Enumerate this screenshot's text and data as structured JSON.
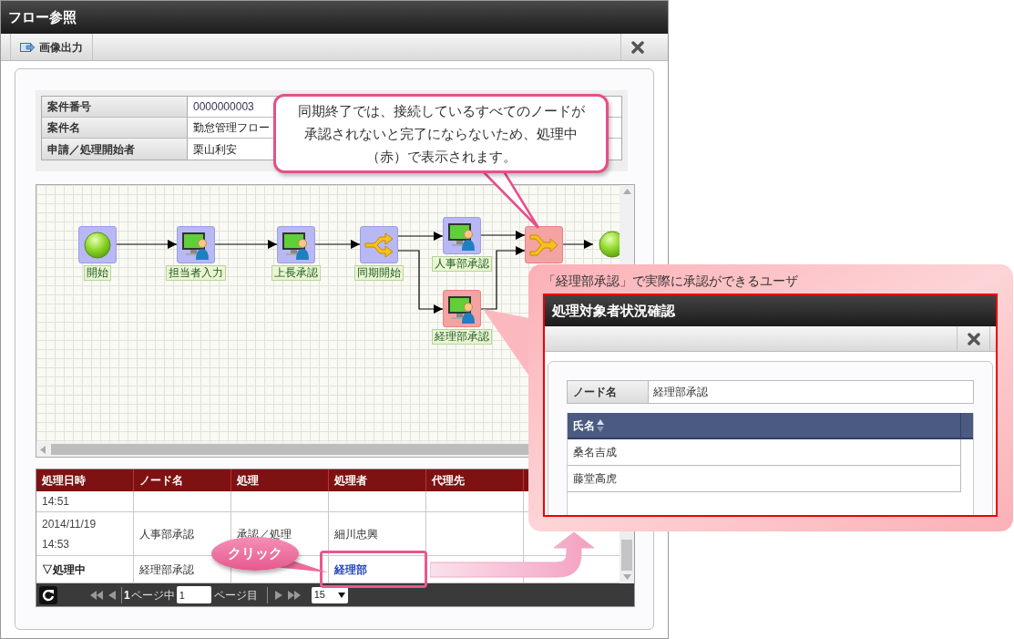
{
  "window": {
    "title": "フロー参照"
  },
  "toolbar": {
    "buttons": [
      {
        "label": "画像出力"
      }
    ]
  },
  "case_info": [
    {
      "label": "案件番号",
      "value": "0000000003",
      "kind": "number"
    },
    {
      "label": "案件名",
      "value": "勤怠管理フロー",
      "kind": "text"
    },
    {
      "label": "申請／処理開始者",
      "value": "栗山利安",
      "kind": "text"
    }
  ],
  "flow_diagram": {
    "nodes": [
      {
        "kind": "start",
        "label": "開始",
        "active": false
      },
      {
        "kind": "task",
        "label": "担当者入力",
        "active": false
      },
      {
        "kind": "task",
        "label": "上長承認",
        "active": false
      },
      {
        "kind": "split",
        "label": "同期開始",
        "active": false
      },
      {
        "kind": "task",
        "label": "人事部承認",
        "active": false
      },
      {
        "kind": "task",
        "label": "経理部承認",
        "active": true
      },
      {
        "kind": "join",
        "active": true
      },
      {
        "kind": "end"
      }
    ]
  },
  "history": {
    "columns": [
      "処理日時",
      "ノード名",
      "処理",
      "処理者",
      "代理先"
    ],
    "rows": [
      {
        "datetime": "14:51",
        "in_progress": false
      },
      {
        "datetime": "2014/11/19\n14:53",
        "in_progress": false,
        "node": "人事部承認",
        "action": "承認／処理",
        "processor": "細川忠興"
      },
      {
        "datetime": "▽処理中",
        "in_progress": true,
        "node": "経理部承認",
        "processor_link": "経理部"
      }
    ]
  },
  "pager": {
    "total_pages": "1",
    "of_label": "ページ中",
    "page_input": "1",
    "page_label": "ページ目",
    "page_size": "15"
  },
  "notes": {
    "join_note_lines": [
      "同期終了では、接続しているすべてのノードが",
      "承認されないと完了にならないため、処理中",
      "（赤）で表示されます。"
    ],
    "click_label": "クリック",
    "popup_caption": "「経理部承認」で実際に承認ができるユーザ"
  },
  "approver_dialog": {
    "title": "処理対象者状況確認",
    "field": {
      "label": "ノード名",
      "value": "経理部承認"
    },
    "columns": [
      "氏名"
    ],
    "rows": [
      "桑名吉成",
      "藤堂高虎"
    ]
  }
}
